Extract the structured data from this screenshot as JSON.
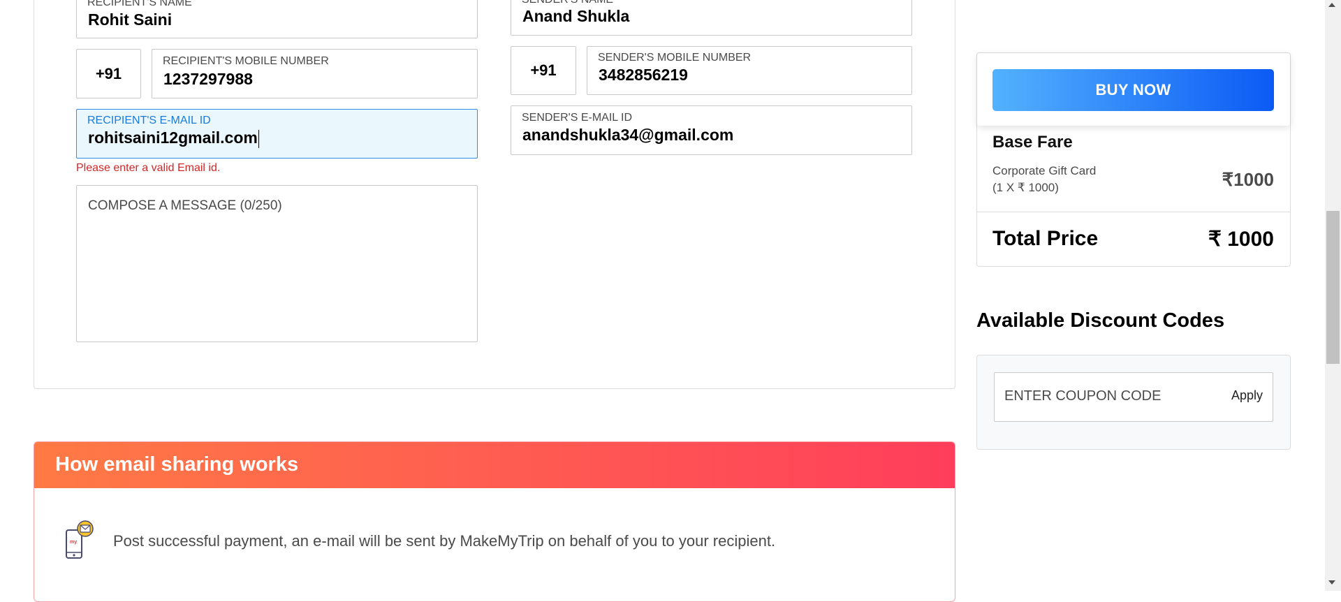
{
  "recipient": {
    "name_label": "RECIPIENT'S NAME",
    "name_value": "Rohit Saini",
    "country_code": "+91",
    "mobile_label": "RECIPIENT'S MOBILE NUMBER",
    "mobile_value": "1237297988",
    "email_label": "RECIPIENT'S E-MAIL ID",
    "email_value": "rohitsaini12gmail.com",
    "email_error": "Please enter a valid Email id.",
    "message_placeholder": "COMPOSE A MESSAGE (0/250)"
  },
  "sender": {
    "name_label": "SENDER'S NAME",
    "name_value": "Anand Shukla",
    "country_code": "+91",
    "mobile_label": "SENDER'S MOBILE NUMBER",
    "mobile_value": "3482856219",
    "email_label": "SENDER'S E-MAIL ID",
    "email_value": "anandshukla34@gmail.com"
  },
  "how_it_works": {
    "title": "How email sharing works",
    "text": "Post successful payment, an e-mail will be sent by MakeMyTrip on behalf of you to your recipient.",
    "icon": "phone-email-icon"
  },
  "price": {
    "buy_label": "BUY NOW",
    "base_fare_label": "Base Fare",
    "item_name": "Corporate Gift Card",
    "item_qty": "(1 X ₹ 1000)",
    "item_price": "₹1000",
    "total_label": "Total Price",
    "total_value": "₹ 1000"
  },
  "discount": {
    "title": "Available Discount Codes",
    "coupon_placeholder": "ENTER COUPON CODE",
    "apply_label": "Apply"
  },
  "colors": {
    "buy_gradient_start": "#53b2fe",
    "buy_gradient_end": "#0b5af5",
    "header_gradient_start": "#ff7a45",
    "header_gradient_end": "#ff3e5b",
    "error": "#d32727",
    "active_field_border": "#2f8ee8"
  }
}
